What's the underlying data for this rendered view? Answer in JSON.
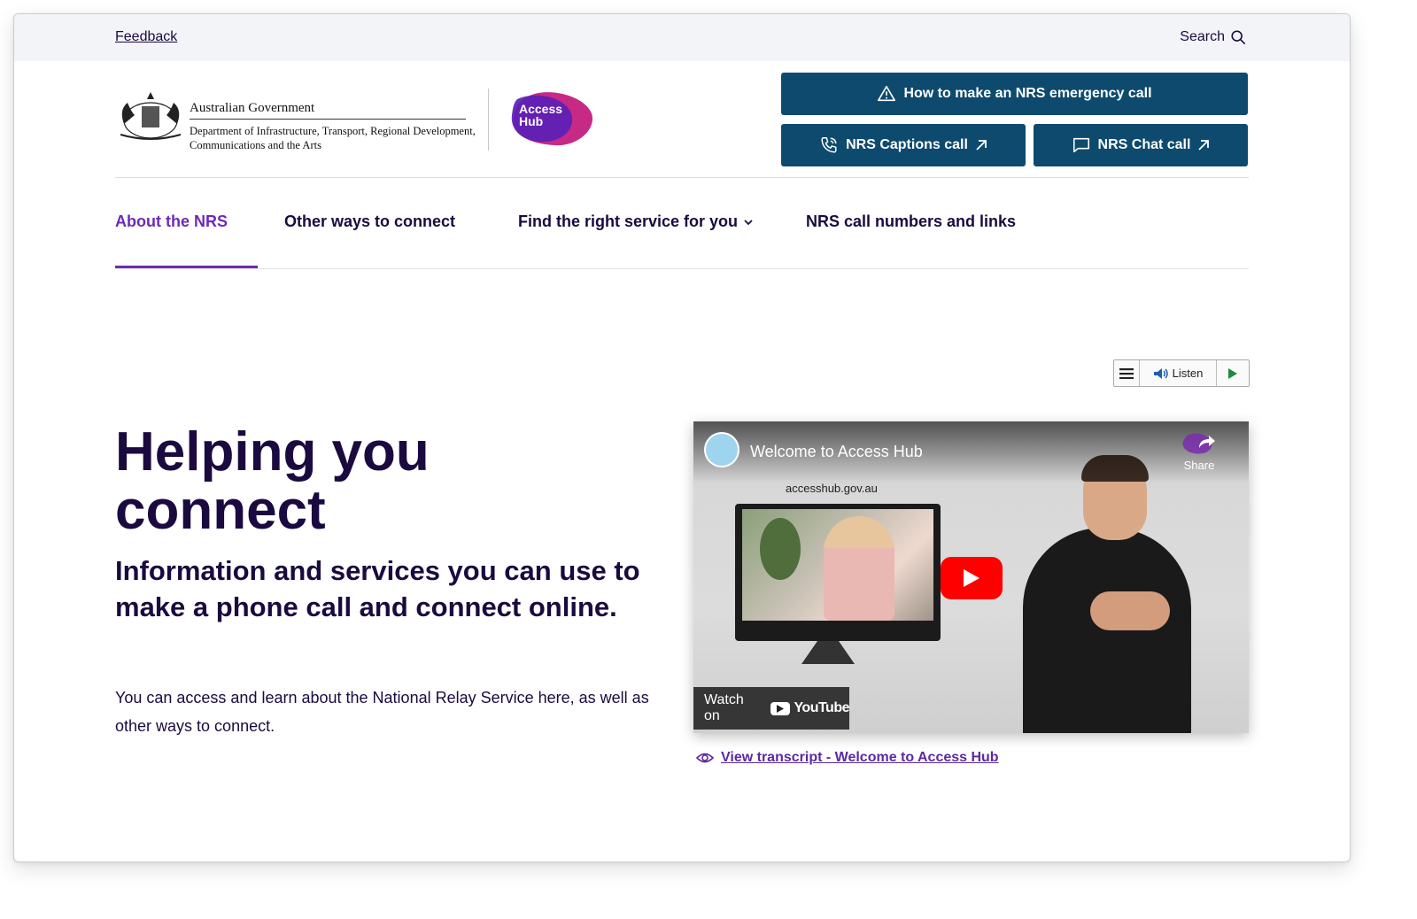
{
  "utility": {
    "feedback_label": "Feedback",
    "search_label": "Search"
  },
  "header": {
    "gov_title": "Australian Government",
    "department": "Department of Infrastructure, Transport, Regional Development, Communications and the Arts",
    "access_hub_logo_text_line1": "Access",
    "access_hub_logo_text_line2": "Hub",
    "buttons": {
      "emergency": "How to make an NRS emergency call",
      "captions": "NRS Captions call",
      "chat": "NRS Chat call"
    }
  },
  "nav": {
    "items": [
      {
        "label": "About the NRS",
        "active": true
      },
      {
        "label": "Other ways to connect",
        "active": false
      },
      {
        "label": "Find the right service for you",
        "active": false,
        "has_dropdown": true
      },
      {
        "label": "NRS call numbers and links",
        "active": false
      }
    ]
  },
  "listen_widget": {
    "label": "Listen"
  },
  "hero": {
    "title": "Helping you connect",
    "subtitle": "Information and services you can use to make a phone call and connect online.",
    "body": "You can access and learn about the National Relay Service here, as well as other ways to connect."
  },
  "video": {
    "title": "Welcome to Access Hub",
    "url_overlay": "accesshub.gov.au",
    "share_label": "Share",
    "watch_on_label": "Watch on",
    "youtube_label": "YouTube"
  },
  "transcript": {
    "label": "View transcript - Welcome to Access Hub"
  },
  "colors": {
    "primary_button": "#0d4a6e",
    "nav_active": "#6c2bb4",
    "heading": "#1b0a3f",
    "link": "#5b2aa0",
    "youtube_red": "#ff0000"
  }
}
